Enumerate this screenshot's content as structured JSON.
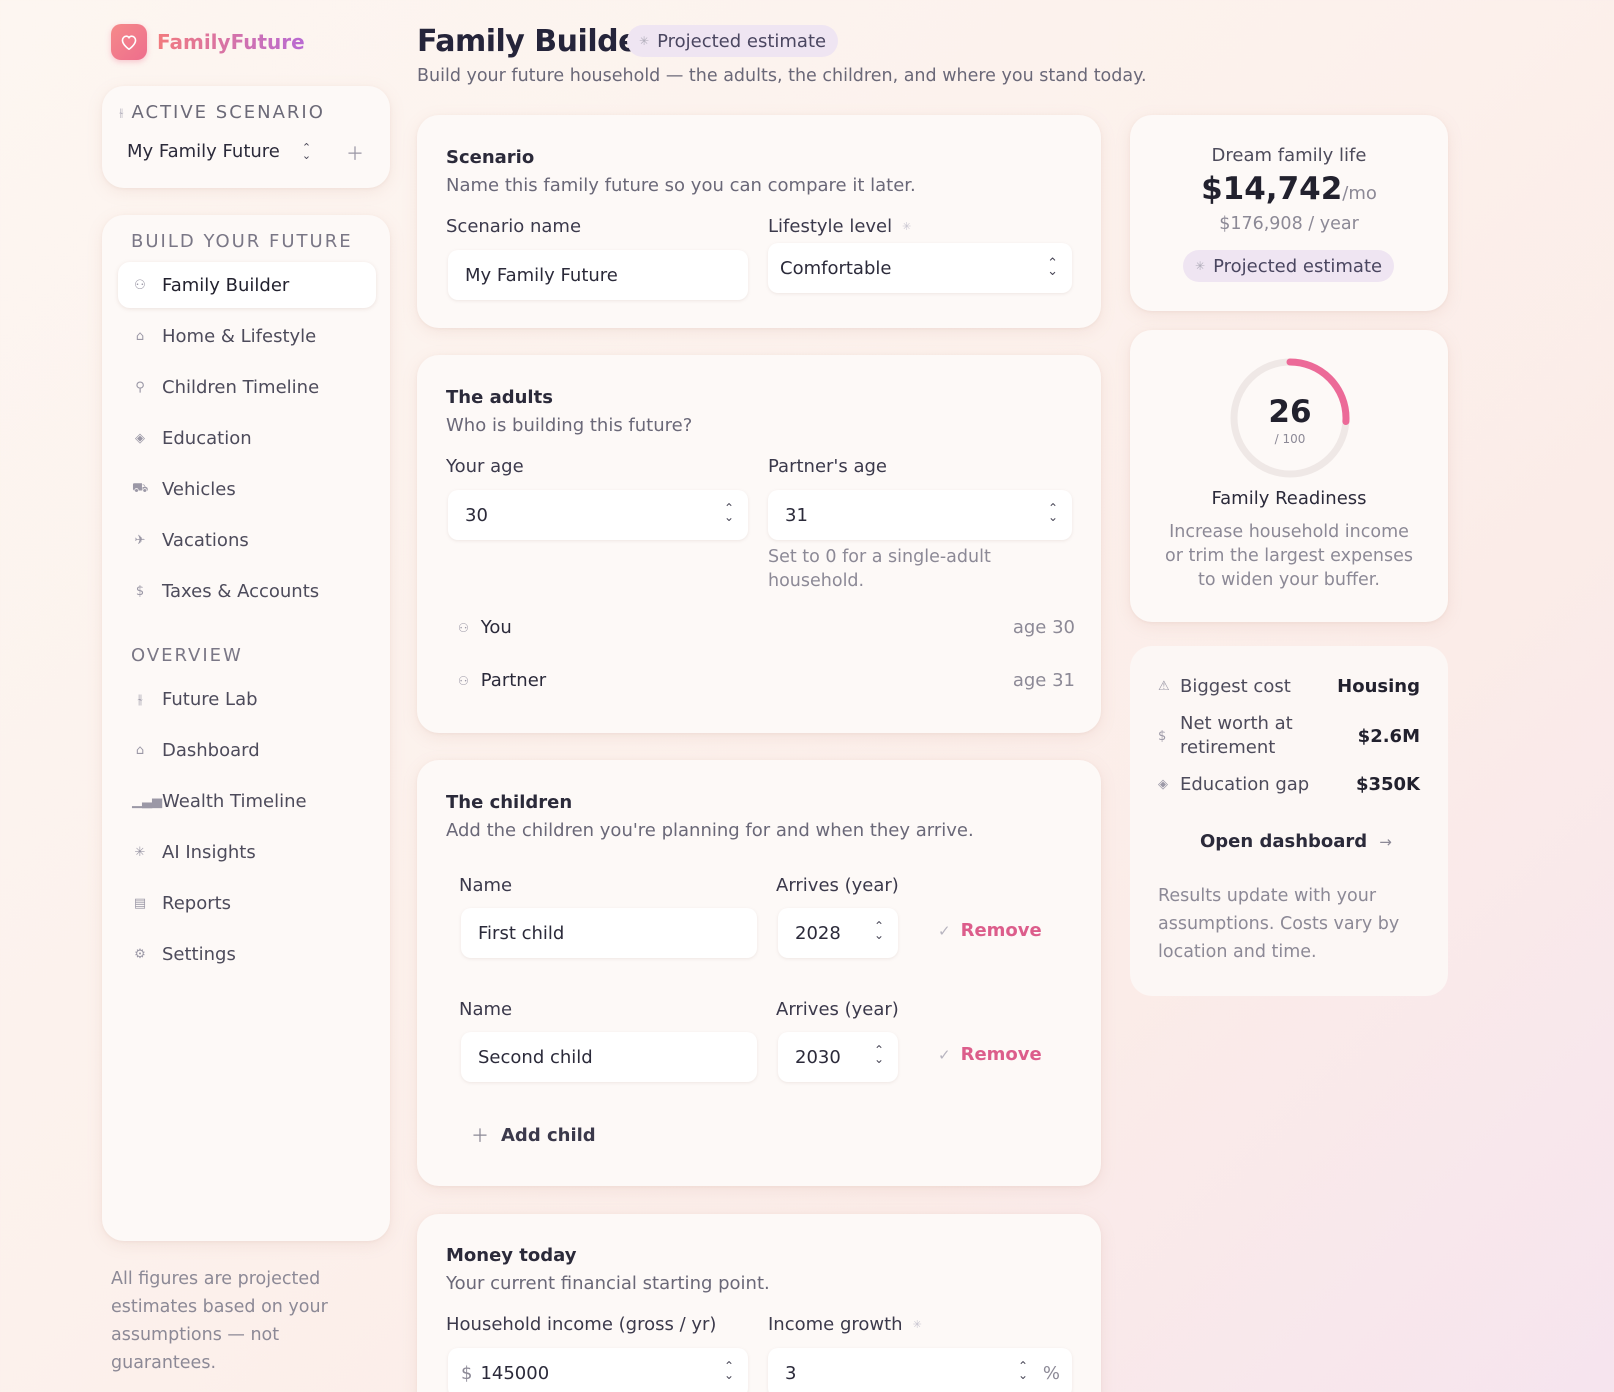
{
  "app": {
    "name": "FamilyFuture",
    "accent": "#ee6d8d",
    "accent_secondary": "#b86ad3"
  },
  "sidebar": {
    "scenario_eyebrow": "Active Scenario",
    "scenario_value": "My Family Future",
    "build_heading": "Build your future",
    "build_items": [
      {
        "label": "Family Builder",
        "icon": "people-icon",
        "active": true
      },
      {
        "label": "Home & Lifestyle",
        "icon": "home-icon"
      },
      {
        "label": "Children Timeline",
        "icon": "child-icon"
      },
      {
        "label": "Education",
        "icon": "graduation-cap-icon"
      },
      {
        "label": "Vehicles",
        "icon": "car-icon"
      },
      {
        "label": "Vacations",
        "icon": "plane-icon"
      },
      {
        "label": "Taxes & Accounts",
        "icon": "dollar-icon"
      }
    ],
    "overview_heading": "Overview",
    "overview_items": [
      {
        "label": "Future Lab",
        "icon": "sliders-icon"
      },
      {
        "label": "Dashboard",
        "icon": "home-outline-icon"
      },
      {
        "label": "Wealth Timeline",
        "icon": "bar-chart-icon"
      },
      {
        "label": "AI Insights",
        "icon": "sparkle-icon"
      },
      {
        "label": "Reports",
        "icon": "document-icon"
      },
      {
        "label": "Settings",
        "icon": "gear-icon"
      }
    ],
    "footnote": "All figures are projected estimates based on your assumptions — not guarantees."
  },
  "header": {
    "title": "Family Builder",
    "badge": "Projected estimate",
    "subtitle": "Build your future household — the adults, the children, and where you stand today."
  },
  "scenario_card": {
    "title": "Scenario",
    "subtitle": "Name this family future so you can compare it later.",
    "name_label": "Scenario name",
    "name_value": "My Family Future",
    "lifestyle_label": "Lifestyle level",
    "lifestyle_value": "Comfortable"
  },
  "adults_card": {
    "title": "The adults",
    "subtitle": "Who is building this future?",
    "your_age_label": "Your age",
    "your_age_value": "30",
    "partner_age_label": "Partner's age",
    "partner_age_value": "31",
    "partner_help": "Set to 0 for a single-adult household.",
    "people": [
      {
        "name": "You",
        "age": "age 30"
      },
      {
        "name": "Partner",
        "age": "age 31"
      }
    ]
  },
  "children_card": {
    "title": "The children",
    "subtitle": "Add the children you're planning for and when they arrive.",
    "name_label": "Name",
    "year_label": "Arrives (year)",
    "remove_label": "Remove",
    "children": [
      {
        "name": "First child",
        "year": "2028"
      },
      {
        "name": "Second child",
        "year": "2030"
      }
    ],
    "add_label": "Add child"
  },
  "money_card": {
    "title": "Money today",
    "subtitle": "Your current financial starting point.",
    "income_label": "Household income (gross / yr)",
    "income_prefix": "$",
    "income_value": "145000",
    "growth_label": "Income growth",
    "growth_value": "3",
    "growth_suffix": "%"
  },
  "dream_card": {
    "label": "Dream family life",
    "amount": "$14,742",
    "per": "/mo",
    "yearly": "$176,908 / year",
    "badge": "Projected estimate"
  },
  "readiness_card": {
    "score": "26",
    "score_max": "/ 100",
    "score_value": 26,
    "title": "Family Readiness",
    "text": "Increase household income or trim the largest expenses to widen your buffer."
  },
  "summary_card": {
    "rows": [
      {
        "label": "Biggest cost",
        "value": "Housing",
        "icon": "warning-icon"
      },
      {
        "label": "Net worth at retirement",
        "value": "$2.6M",
        "icon": "dollar-icon"
      },
      {
        "label": "Education gap",
        "value": "$350K",
        "icon": "graduation-cap-icon"
      }
    ],
    "open_label": "Open dashboard",
    "note": "Results update with your assumptions. Costs vary by location and time."
  }
}
